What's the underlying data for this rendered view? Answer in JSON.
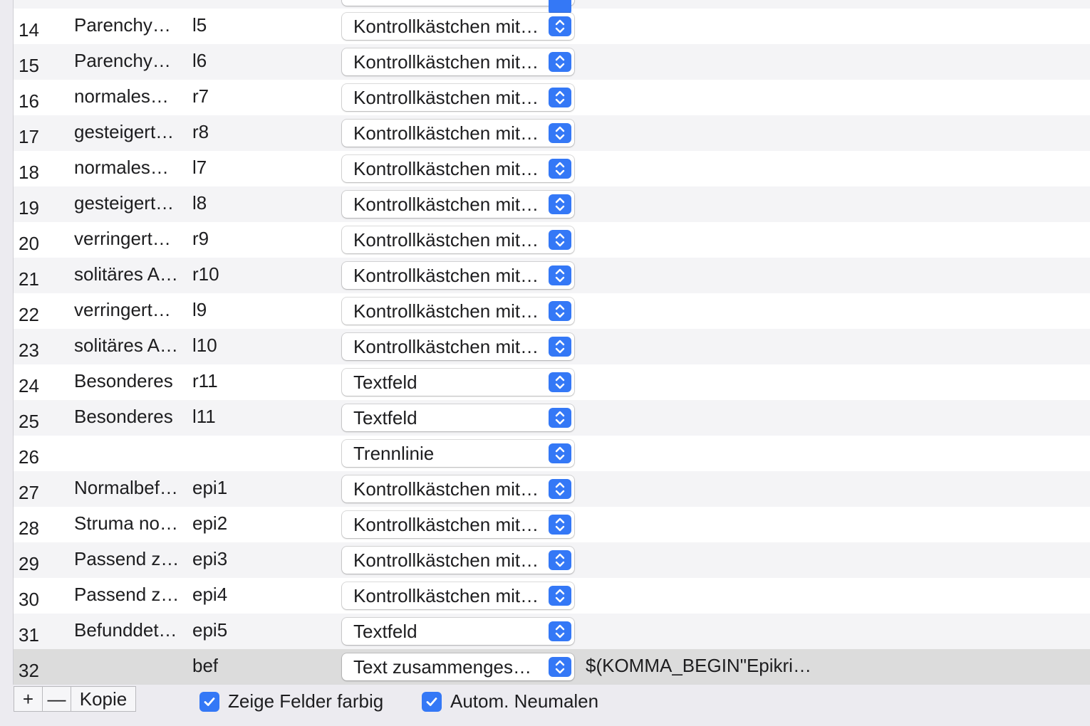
{
  "table": {
    "rows": [
      {
        "num": "14",
        "label": "Parenchy…",
        "name": "l5",
        "type": "Kontrollkästchen mit…",
        "value": ""
      },
      {
        "num": "15",
        "label": "Parenchy…",
        "name": "l6",
        "type": "Kontrollkästchen mit…",
        "value": ""
      },
      {
        "num": "16",
        "label": "normales…",
        "name": "r7",
        "type": "Kontrollkästchen mit…",
        "value": ""
      },
      {
        "num": "17",
        "label": "gesteigert…",
        "name": "r8",
        "type": "Kontrollkästchen mit…",
        "value": ""
      },
      {
        "num": "18",
        "label": "normales…",
        "name": "l7",
        "type": "Kontrollkästchen mit…",
        "value": ""
      },
      {
        "num": "19",
        "label": "gesteigert…",
        "name": "l8",
        "type": "Kontrollkästchen mit…",
        "value": ""
      },
      {
        "num": "20",
        "label": "verringert…",
        "name": "r9",
        "type": "Kontrollkästchen mit…",
        "value": ""
      },
      {
        "num": "21",
        "label": "solitäres A…",
        "name": "r10",
        "type": "Kontrollkästchen mit…",
        "value": ""
      },
      {
        "num": "22",
        "label": "verringert…",
        "name": "l9",
        "type": "Kontrollkästchen mit…",
        "value": ""
      },
      {
        "num": "23",
        "label": "solitäres A…",
        "name": "l10",
        "type": "Kontrollkästchen mit…",
        "value": ""
      },
      {
        "num": "24",
        "label": "Besonderes",
        "name": "r11",
        "type": "Textfeld",
        "value": ""
      },
      {
        "num": "25",
        "label": "Besonderes",
        "name": "l11",
        "type": "Textfeld",
        "value": ""
      },
      {
        "num": "26",
        "label": "",
        "name": "",
        "type": "Trennlinie",
        "value": ""
      },
      {
        "num": "27",
        "label": "Normalbef…",
        "name": "epi1",
        "type": "Kontrollkästchen mit…",
        "value": ""
      },
      {
        "num": "28",
        "label": "Struma no…",
        "name": "epi2",
        "type": "Kontrollkästchen mit…",
        "value": ""
      },
      {
        "num": "29",
        "label": "Passend z…",
        "name": "epi3",
        "type": "Kontrollkästchen mit…",
        "value": ""
      },
      {
        "num": "30",
        "label": "Passend z…",
        "name": "epi4",
        "type": "Kontrollkästchen mit…",
        "value": ""
      },
      {
        "num": "31",
        "label": "Befunddet…",
        "name": "epi5",
        "type": "Textfeld",
        "value": ""
      },
      {
        "num": "32",
        "label": "",
        "name": "bef",
        "type": "Text zusammengese…",
        "value": "$(KOMMA_BEGIN\"Epikri…"
      }
    ]
  },
  "toolbar": {
    "add_label": "+",
    "remove_label": "—",
    "copy_label": "Kopie",
    "show_colored_label": "Zeige Felder farbig",
    "auto_redraw_label": "Autom. Neumalen"
  },
  "colors": {
    "accent": "#3478f6",
    "row_alt": "#f4f4f6",
    "row_selected": "#dcdcdc"
  },
  "icons": {
    "popup_stepper": "up-down-chevron-icon",
    "checkbox": "checkmark-icon"
  }
}
